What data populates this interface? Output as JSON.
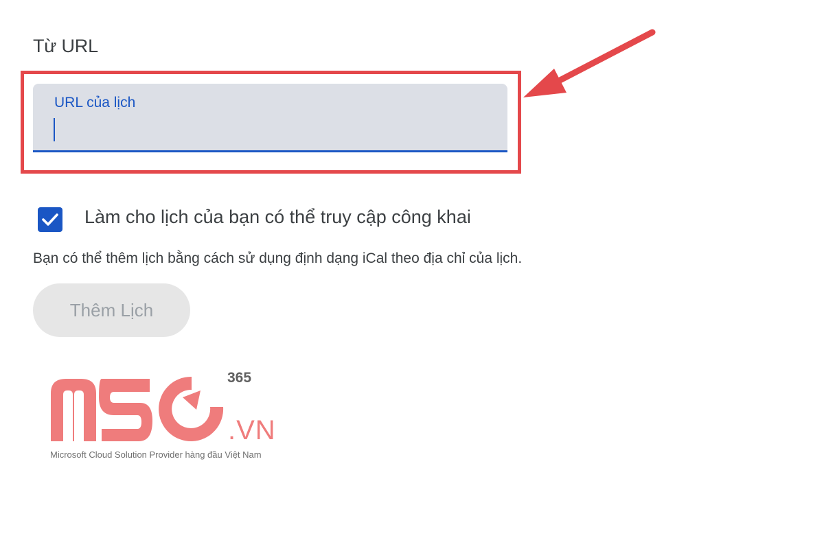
{
  "section": {
    "title": "Từ URL"
  },
  "url_field": {
    "label": "URL của lịch",
    "value": ""
  },
  "public_option": {
    "label": "Làm cho lịch của bạn có thể truy cập công khai",
    "checked": true
  },
  "helper": {
    "text": "Bạn có thể thêm lịch bằng cách sử dụng định dạng iCal theo địa chỉ của lịch."
  },
  "actions": {
    "add_calendar_label": "Thêm Lịch"
  },
  "watermark": {
    "brand": "MSO",
    "superscript": "365",
    "domain": ".VN",
    "tagline": "Microsoft Cloud Solution Provider hàng đầu Việt Nam"
  },
  "icons": {
    "check": "checkmark-icon",
    "arrow": "arrow-pointer-icon"
  },
  "colors": {
    "accent": "#1a56c4",
    "highlight": "#e4484b",
    "logo": "#ef7c7c"
  }
}
